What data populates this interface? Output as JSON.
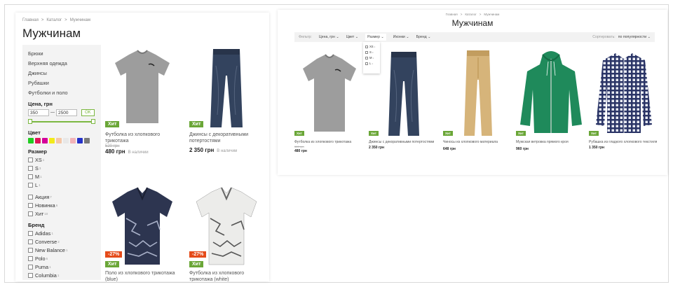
{
  "left": {
    "breadcrumb": [
      "Главная",
      ">",
      "Каталог",
      ">",
      "Мужчинам"
    ],
    "title": "Мужчинам",
    "categories": [
      "Брюки",
      "Верхняя одежда",
      "Джинсы",
      "Рубашки",
      "Футболки и поло"
    ],
    "price": {
      "title": "Цена, грн",
      "min": "350",
      "max": "2500",
      "dash": "—",
      "ok": "OK"
    },
    "color": {
      "title": "Цвет",
      "swatches": [
        "#22cc22",
        "#e0145b",
        "#d4009a",
        "#f2ea1a",
        "#f5c6a6",
        "#e8e8e8",
        "#f2b3b8",
        "#2431c8",
        "#7a7a7a"
      ]
    },
    "size": {
      "title": "Размер",
      "items": [
        {
          "label": "XS",
          "count": "1"
        },
        {
          "label": "S",
          "count": "3"
        },
        {
          "label": "M",
          "count": "1"
        },
        {
          "label": "L",
          "count": "1"
        }
      ]
    },
    "promo": {
      "items": [
        {
          "label": "Акция",
          "count": "7"
        },
        {
          "label": "Новинка",
          "count": "6"
        },
        {
          "label": "Хит",
          "count": "10"
        }
      ]
    },
    "brand": {
      "title": "Бренд",
      "items": [
        {
          "label": "Adidas",
          "count": "1"
        },
        {
          "label": "Converse",
          "count": "2"
        },
        {
          "label": "New Balance",
          "count": "1"
        },
        {
          "label": "Polo",
          "count": "6"
        },
        {
          "label": "Puma",
          "count": "1"
        },
        {
          "label": "Columbia",
          "count": "1"
        }
      ]
    },
    "products": [
      {
        "name": "Футболка из хлопкового трикотажа",
        "old_price": "520 грн",
        "price": "480 грн",
        "availability": "В наличии",
        "badges": [
          "Хит"
        ],
        "icon": "tshirt-gray-icon"
      },
      {
        "name": "Джинсы с декоративными потертостями",
        "old_price": "",
        "price": "2 350 грн",
        "availability": "В наличии",
        "badges": [
          "Хит"
        ],
        "icon": "jeans-icon"
      },
      {
        "name": "Поло из хлопкового трикотажа (blue)",
        "badges": [
          "-27%",
          "Хит"
        ],
        "icon": "polo-navy-icon"
      },
      {
        "name": "Футболка из хлопкового трикотажа (white)",
        "badges": [
          "-27%",
          "Хит"
        ],
        "icon": "polo-white-icon"
      }
    ]
  },
  "right": {
    "breadcrumb": [
      "Главная",
      ">",
      "Каталог",
      ">",
      "Мужчинам"
    ],
    "title": "Мужчинам",
    "filter_label": "Фильтр:",
    "filters": [
      "Цена, грн",
      "Цвет",
      "Размер",
      "Иконки",
      "Бренд"
    ],
    "active_filter": "Размер",
    "sort_label": "Сортировать:",
    "sort_value": "по популярности",
    "dropdown": [
      {
        "label": "XS",
        "count": "1"
      },
      {
        "label": "S",
        "count": "3"
      },
      {
        "label": "M",
        "count": "1"
      },
      {
        "label": "L",
        "count": "1"
      }
    ],
    "products": [
      {
        "name": "Футболка из хлопкового трикотажа",
        "old_price": "520 грн",
        "price": "480 грн",
        "badge": "Хит",
        "icon": "tshirt-gray-icon"
      },
      {
        "name": "Джинсы с декоративными потертостями",
        "old_price": "",
        "price": "2 350 грн",
        "badge": "Хит",
        "icon": "jeans-icon"
      },
      {
        "name": "Чиносы из хлопкового материала",
        "old_price": "",
        "price": "648 грн",
        "badge": "Хит",
        "icon": "chinos-icon"
      },
      {
        "name": "Мужская ветровка прямого кроя",
        "old_price": "",
        "price": "960 грн",
        "badge": "Хит",
        "icon": "green-jacket-icon"
      },
      {
        "name": "Рубашка из гладкого хлопкового текстиля",
        "old_price": "",
        "price": "1 350 грн",
        "badge": "Хит",
        "icon": "plaid-shirt-icon"
      }
    ]
  }
}
